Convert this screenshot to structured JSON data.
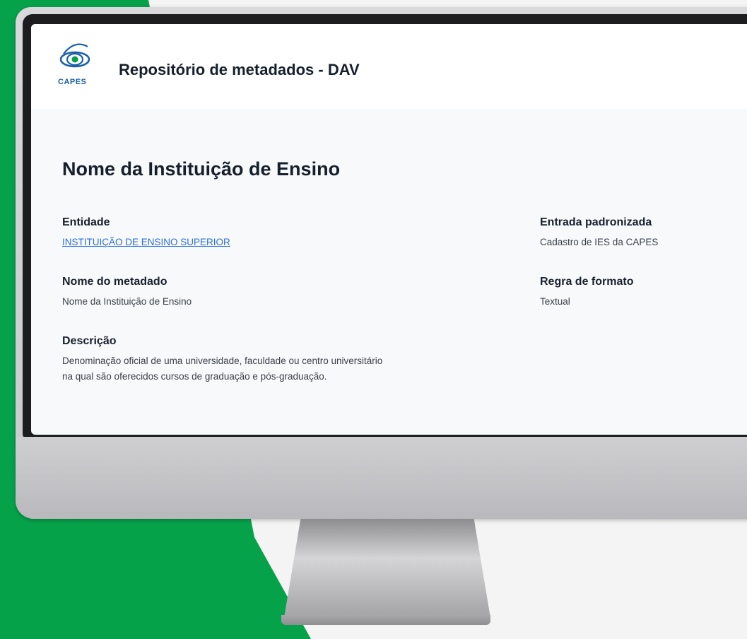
{
  "header": {
    "logo_text": "CAPES",
    "app_title": "Repositório de metadados - DAV"
  },
  "page": {
    "title": "Nome da Instituição de Ensino"
  },
  "fields": {
    "entidade": {
      "label": "Entidade",
      "value": "INSTITUIÇÃO DE ENSINO SUPERIOR"
    },
    "nome_metadado": {
      "label": "Nome do metadado",
      "value": "Nome da Instituição de Ensino"
    },
    "descricao": {
      "label": "Descrição",
      "line1": "Denominação oficial de uma universidade, faculdade ou centro universitário",
      "line2": "na qual são oferecidos cursos de graduação e pós-graduação."
    },
    "entrada_padronizada": {
      "label": "Entrada padronizada",
      "value": "Cadastro de IES da CAPES"
    },
    "regra_formato": {
      "label": "Regra de formato",
      "value": "Textual"
    }
  },
  "colors": {
    "brand_green": "#06a24a",
    "link_blue": "#2a6fd6",
    "logo_blue": "#1b5fa8"
  }
}
